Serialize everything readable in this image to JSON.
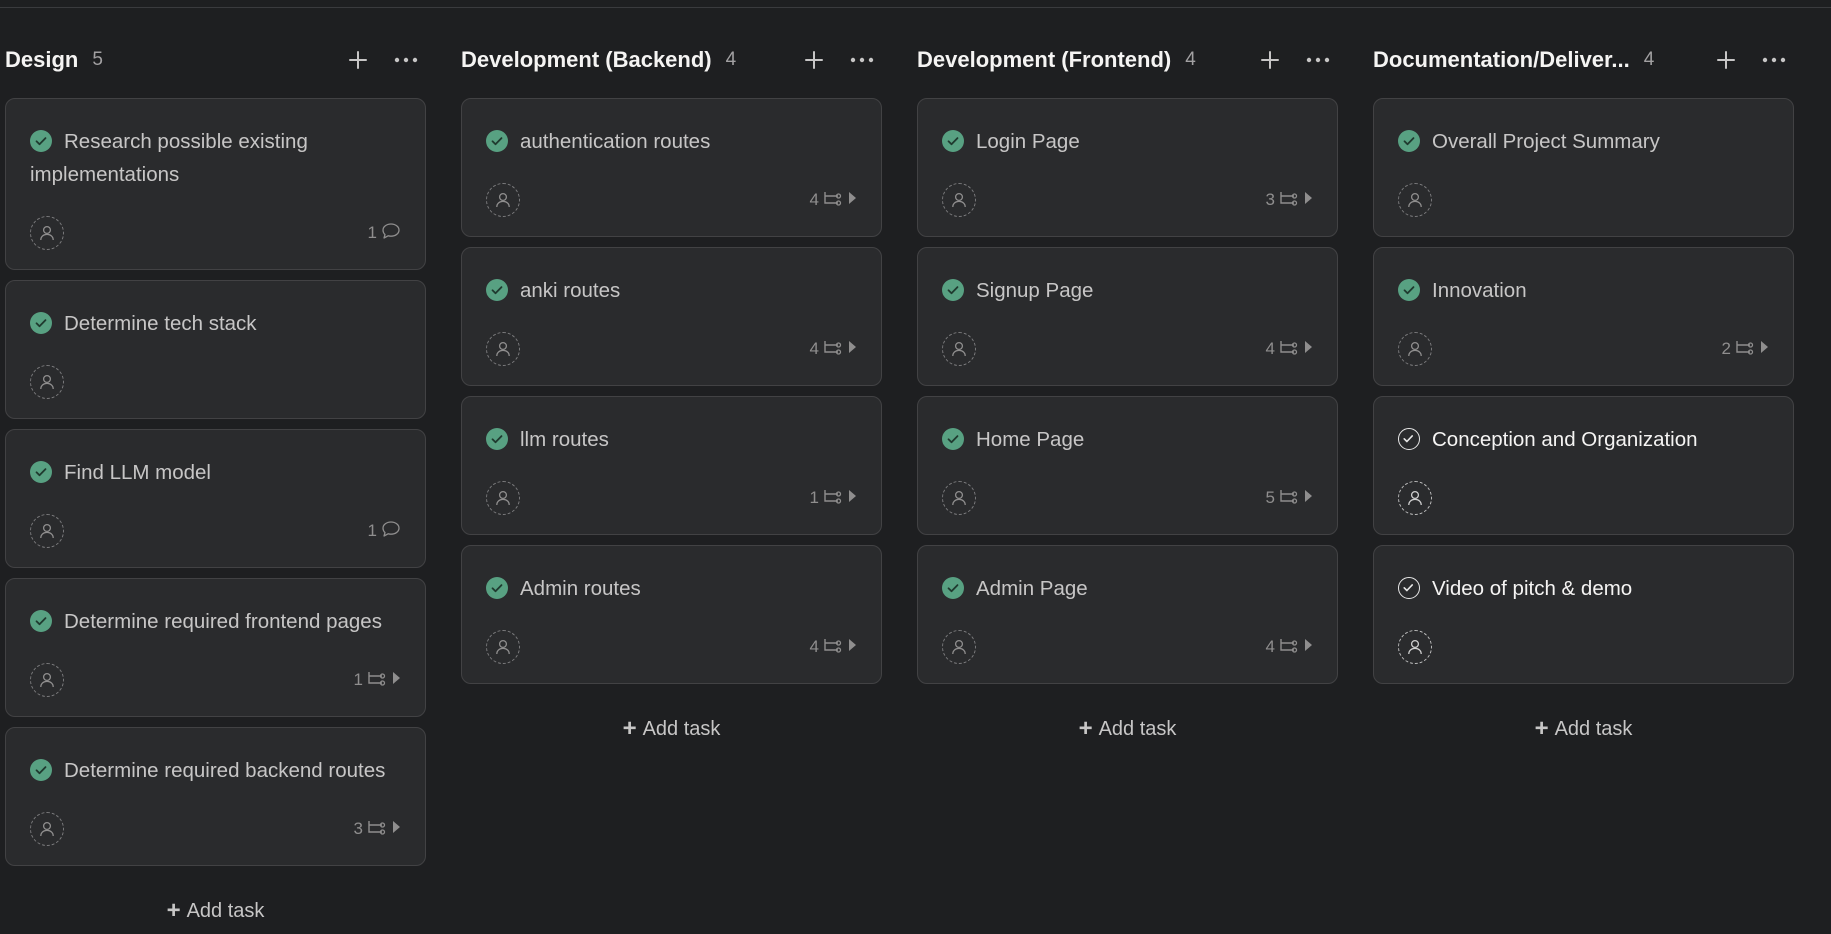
{
  "columns": [
    {
      "title": "Design",
      "count": "5",
      "add_label": "Add task",
      "cards": [
        {
          "title": "Research possible existing implementations",
          "done": true,
          "meta_count": "1",
          "meta_type": "comment",
          "layout": "tall"
        },
        {
          "title": "Determine tech stack",
          "done": true,
          "meta_count": "",
          "meta_type": "none",
          "layout": "short"
        },
        {
          "title": "Find LLM model",
          "done": true,
          "meta_count": "1",
          "meta_type": "comment",
          "layout": "short"
        },
        {
          "title": "Determine required frontend pages",
          "done": true,
          "meta_count": "1",
          "meta_type": "subtask",
          "layout": "short"
        },
        {
          "title": "Determine required backend routes",
          "done": true,
          "meta_count": "3",
          "meta_type": "subtask",
          "layout": "short"
        }
      ]
    },
    {
      "title": "Development (Backend)",
      "count": "4",
      "add_label": "Add task",
      "cards": [
        {
          "title": "authentication routes",
          "done": true,
          "meta_count": "4",
          "meta_type": "subtask",
          "layout": "short"
        },
        {
          "title": "anki routes",
          "done": true,
          "meta_count": "4",
          "meta_type": "subtask",
          "layout": "short"
        },
        {
          "title": "llm routes",
          "done": true,
          "meta_count": "1",
          "meta_type": "subtask",
          "layout": "short"
        },
        {
          "title": "Admin routes",
          "done": true,
          "meta_count": "4",
          "meta_type": "subtask",
          "layout": "short"
        }
      ]
    },
    {
      "title": "Development (Frontend)",
      "count": "4",
      "add_label": "Add task",
      "cards": [
        {
          "title": "Login Page",
          "done": true,
          "meta_count": "3",
          "meta_type": "subtask",
          "layout": "short"
        },
        {
          "title": "Signup Page",
          "done": true,
          "meta_count": "4",
          "meta_type": "subtask",
          "layout": "short"
        },
        {
          "title": "Home Page",
          "done": true,
          "meta_count": "5",
          "meta_type": "subtask",
          "layout": "short"
        },
        {
          "title": "Admin Page",
          "done": true,
          "meta_count": "4",
          "meta_type": "subtask",
          "layout": "short"
        }
      ]
    },
    {
      "title": "Documentation/Deliver...",
      "count": "4",
      "add_label": "Add task",
      "cards": [
        {
          "title": "Overall Project Summary",
          "done": true,
          "meta_count": "",
          "meta_type": "none",
          "layout": "short"
        },
        {
          "title": "Innovation",
          "done": true,
          "meta_count": "2",
          "meta_type": "subtask",
          "layout": "short"
        },
        {
          "title": "Conception and Organization",
          "done": false,
          "meta_count": "",
          "meta_type": "none",
          "layout": "short"
        },
        {
          "title": "Video of pitch & demo",
          "done": false,
          "meta_count": "",
          "meta_type": "none",
          "layout": "short"
        }
      ]
    }
  ],
  "colors": {
    "background": "#1e1f21",
    "card": "#2a2b2d",
    "card_border": "#424244",
    "check_done": "#58a182",
    "text_done": "#c7c6c6",
    "text_open": "#f5f4f3",
    "muted": "#8f8e8e"
  },
  "icons": {
    "column_add": "plus-icon",
    "column_menu": "more-horizontal-icon",
    "done": "check-circle-filled-icon",
    "open": "check-circle-outline-icon",
    "assignee": "user-placeholder-icon",
    "comment": "comment-icon",
    "subtask": "subtask-icon",
    "expand": "triangle-right-icon"
  }
}
